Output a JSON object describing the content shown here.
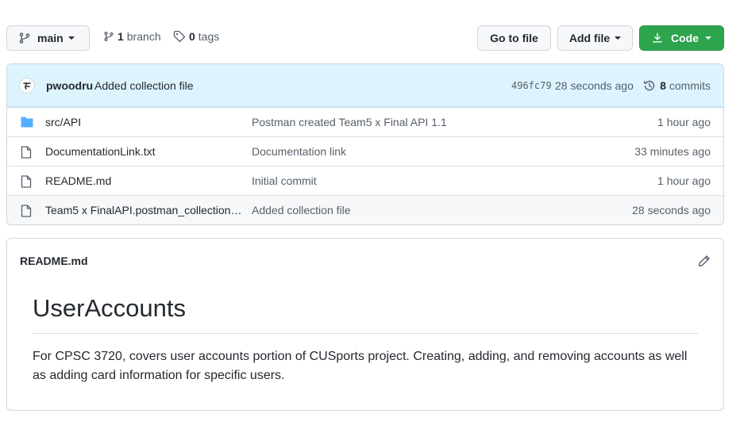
{
  "toolbar": {
    "branch_button": "main",
    "branch_count": "1",
    "branch_word": "branch",
    "tag_count": "0",
    "tag_word": "tags",
    "go_to_file": "Go to file",
    "add_file": "Add file",
    "code": "Code"
  },
  "commit": {
    "author": "pwoodru",
    "message": "Added collection file",
    "sha": "496fc79",
    "time": "28 seconds ago",
    "commit_count": "8",
    "commit_word": "commits"
  },
  "files": [
    {
      "name": "src/API",
      "type": "folder",
      "message": "Postman created Team5 x Final API 1.1",
      "age": "1 hour ago"
    },
    {
      "name": "DocumentationLink.txt",
      "type": "file",
      "message": "Documentation link",
      "age": "33 minutes ago"
    },
    {
      "name": "README.md",
      "type": "file",
      "message": "Initial commit",
      "age": "1 hour ago"
    },
    {
      "name": "Team5 x FinalAPI.postman_collection.j...",
      "type": "file",
      "message": "Added collection file",
      "age": "28 seconds ago"
    }
  ],
  "readme": {
    "filename": "README.md",
    "heading": "UserAccounts",
    "body": "For CPSC 3720, covers user accounts portion of CUSports project. Creating, adding, and removing accounts as well as adding card information for specific users."
  },
  "colors": {
    "accent_green": "#2da44e",
    "commit_bar": "#ddf4ff",
    "folder_blue": "#54aeff"
  }
}
